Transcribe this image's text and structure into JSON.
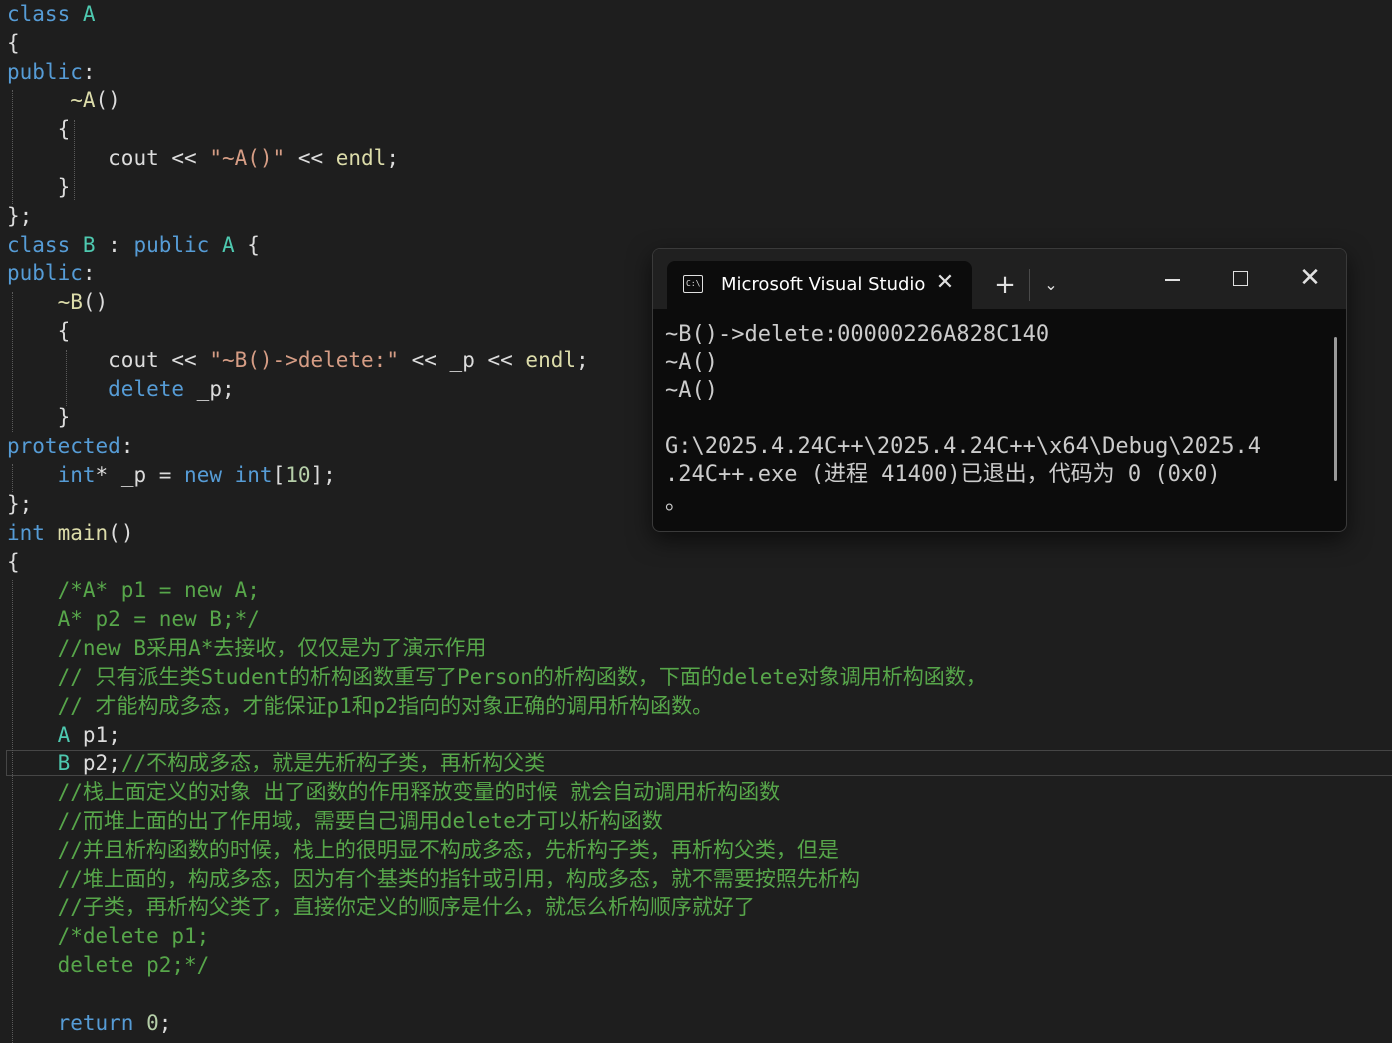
{
  "editor": {
    "lines": [
      [
        [
          "kw",
          "class"
        ],
        [
          "pl",
          " "
        ],
        [
          "ty",
          "A"
        ]
      ],
      [
        [
          "pl",
          "{"
        ]
      ],
      [
        [
          "kw",
          "public"
        ],
        [
          "pl",
          ":"
        ]
      ],
      [
        [
          "pl",
          "     "
        ],
        [
          "fn",
          "~A"
        ],
        [
          "pl",
          "()"
        ]
      ],
      [
        [
          "pl",
          "    {"
        ]
      ],
      [
        [
          "pl",
          "        "
        ],
        [
          "var",
          "cout"
        ],
        [
          "pl",
          " << "
        ],
        [
          "str",
          "\"~A()\""
        ],
        [
          "pl",
          " << "
        ],
        [
          "fn",
          "endl"
        ],
        [
          "pl",
          ";"
        ]
      ],
      [
        [
          "pl",
          "    }"
        ]
      ],
      [
        [
          "pl",
          "};"
        ]
      ],
      [
        [
          "kw",
          "class"
        ],
        [
          "pl",
          " "
        ],
        [
          "ty",
          "B"
        ],
        [
          "pl",
          " : "
        ],
        [
          "kw",
          "public"
        ],
        [
          "pl",
          " "
        ],
        [
          "ty",
          "A"
        ],
        [
          "pl",
          " {"
        ]
      ],
      [
        [
          "kw",
          "public"
        ],
        [
          "pl",
          ":"
        ]
      ],
      [
        [
          "pl",
          "    "
        ],
        [
          "fn",
          "~B"
        ],
        [
          "pl",
          "()"
        ]
      ],
      [
        [
          "pl",
          "    {"
        ]
      ],
      [
        [
          "pl",
          "        "
        ],
        [
          "var",
          "cout"
        ],
        [
          "pl",
          " << "
        ],
        [
          "str",
          "\"~B()->delete:\""
        ],
        [
          "pl",
          " << "
        ],
        [
          "var",
          "_p"
        ],
        [
          "pl",
          " << "
        ],
        [
          "fn",
          "endl"
        ],
        [
          "pl",
          ";"
        ]
      ],
      [
        [
          "pl",
          "        "
        ],
        [
          "kw",
          "delete"
        ],
        [
          "pl",
          " "
        ],
        [
          "var",
          "_p"
        ],
        [
          "pl",
          ";"
        ]
      ],
      [
        [
          "pl",
          "    }"
        ]
      ],
      [
        [
          "kw",
          "protected"
        ],
        [
          "pl",
          ":"
        ]
      ],
      [
        [
          "pl",
          "    "
        ],
        [
          "kw",
          "int"
        ],
        [
          "pl",
          "* "
        ],
        [
          "var",
          "_p"
        ],
        [
          "pl",
          " = "
        ],
        [
          "kw",
          "new"
        ],
        [
          "pl",
          " "
        ],
        [
          "kw",
          "int"
        ],
        [
          "pl",
          "["
        ],
        [
          "num",
          "10"
        ],
        [
          "pl",
          "];"
        ]
      ],
      [
        [
          "pl",
          "};"
        ]
      ],
      [
        [
          "kw",
          "int"
        ],
        [
          "pl",
          " "
        ],
        [
          "fn",
          "main"
        ],
        [
          "pl",
          "()"
        ]
      ],
      [
        [
          "pl",
          "{"
        ]
      ],
      [
        [
          "pl",
          "    "
        ],
        [
          "cm",
          "/*A* p1 = new A;"
        ]
      ],
      [
        [
          "pl",
          "    "
        ],
        [
          "cm",
          "A* p2 = new B;*/"
        ]
      ],
      [
        [
          "pl",
          "    "
        ],
        [
          "cm",
          "//new B采用A*去接收，仅仅是为了演示作用"
        ]
      ],
      [
        [
          "pl",
          "    "
        ],
        [
          "cm",
          "// 只有派生类Student的析构函数重写了Person的析构函数，下面的delete对象调用析构函数，"
        ]
      ],
      [
        [
          "pl",
          "    "
        ],
        [
          "cm",
          "// 才能构成多态，才能保证p1和p2指向的对象正确的调用析构函数。"
        ]
      ],
      [
        [
          "pl",
          "    "
        ],
        [
          "ty",
          "A"
        ],
        [
          "pl",
          " "
        ],
        [
          "var",
          "p1"
        ],
        [
          "pl",
          ";"
        ]
      ],
      [
        [
          "pl",
          "    "
        ],
        [
          "ty",
          "B"
        ],
        [
          "pl",
          " "
        ],
        [
          "var",
          "p2"
        ],
        [
          "pl",
          ";"
        ],
        [
          "cm",
          "//不构成多态，就是先析构子类，再析构父类"
        ]
      ],
      [
        [
          "pl",
          "    "
        ],
        [
          "cm",
          "//栈上面定义的对象 出了函数的作用释放变量的时候 就会自动调用析构函数"
        ]
      ],
      [
        [
          "pl",
          "    "
        ],
        [
          "cm",
          "//而堆上面的出了作用域，需要自己调用delete才可以析构函数"
        ]
      ],
      [
        [
          "pl",
          "    "
        ],
        [
          "cm",
          "//并且析构函数的时候，栈上的很明显不构成多态，先析构子类，再析构父类，但是"
        ]
      ],
      [
        [
          "pl",
          "    "
        ],
        [
          "cm",
          "//堆上面的，构成多态，因为有个基类的指针或引用，构成多态，就不需要按照先析构"
        ]
      ],
      [
        [
          "pl",
          "    "
        ],
        [
          "cm",
          "//子类，再析构父类了，直接你定义的顺序是什么，就怎么析构顺序就好了"
        ]
      ],
      [
        [
          "pl",
          "    "
        ],
        [
          "cm",
          "/*delete p1;"
        ]
      ],
      [
        [
          "pl",
          "    "
        ],
        [
          "cm",
          "delete p2;*/"
        ]
      ],
      [
        [
          "pl",
          ""
        ]
      ],
      [
        [
          "pl",
          "    "
        ],
        [
          "kw",
          "return"
        ],
        [
          "pl",
          " "
        ],
        [
          "num",
          "0"
        ],
        [
          "pl",
          ";"
        ]
      ]
    ]
  },
  "console": {
    "icon_text": "C:\\",
    "icon": "terminal-icon",
    "tab_title": "Microsoft Visual Studio",
    "close_tab": "✕",
    "new_tab": "+",
    "dropdown": "⌄",
    "close": "✕",
    "output": [
      "~B()->delete:00000226A828C140",
      "~A()",
      "~A()",
      "",
      "G:\\2025.4.24C++\\2025.4.24C++\\x64\\Debug\\2025.4",
      ".24C++.exe (进程 41400)已退出，代码为 0 (0x0)",
      "。"
    ]
  },
  "colors": {
    "editor_bg": "#1e1e1e",
    "keyword": "#569cd6",
    "type": "#4ec9b0",
    "string": "#d69d85",
    "function": "#dcdcaa",
    "comment": "#57a64a",
    "number": "#b5cea8",
    "console_bg": "#0c0c0c"
  }
}
